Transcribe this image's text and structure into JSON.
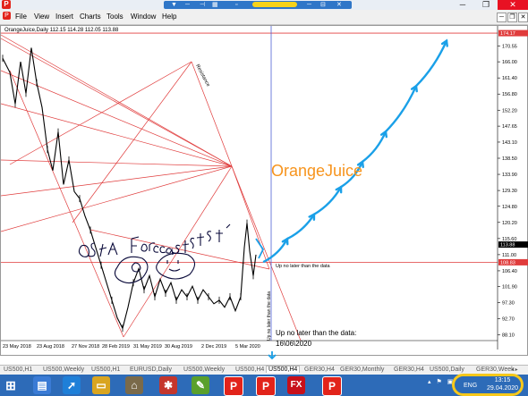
{
  "menu": [
    "File",
    "View",
    "Insert",
    "Charts",
    "Tools",
    "Window",
    "Help"
  ],
  "chart": {
    "header": "OrangeJuice,Daily  112.15 114.28 112.05 113.88",
    "watermark": "OrangeJuice",
    "note_short": "Up no later than the data",
    "note_vertical": "Up no later than the data",
    "note_long": [
      "Up no later than the data:",
      "16\\06\\2020"
    ],
    "trend_label": "Resistance",
    "current_price": "113.88",
    "line_price": "108.83",
    "top_price": "174.17"
  },
  "chart_data": {
    "type": "line",
    "title": "OrangeJuice,Daily",
    "symbol": "OrangeJuice",
    "timeframe": "Daily",
    "ohlc": {
      "open": 112.15,
      "high": 114.28,
      "low": 112.05,
      "close": 113.88
    },
    "x_ticks": [
      "23 May 2018",
      "23 Aug 2018",
      "27 Nov 2018",
      "28 Feb 2019",
      "31 May 2019",
      "30 Aug 2019",
      "2 Dec 2019",
      "5 Mar 2020"
    ],
    "y_ticks": [
      170.55,
      166.0,
      161.4,
      156.8,
      152.2,
      147.65,
      143.1,
      138.5,
      133.9,
      129.3,
      124.8,
      120.2,
      115.6,
      111.0,
      106.4,
      101.9,
      97.3,
      92.7,
      88.1
    ],
    "ylim": [
      86.5,
      174.7
    ],
    "price_labels": {
      "top_line": 174.17,
      "current": 113.88,
      "horizontal_line": 108.83
    },
    "price_path": [
      {
        "x": 0,
        "y": 167
      },
      {
        "x": 8,
        "y": 163
      },
      {
        "x": 14,
        "y": 154
      },
      {
        "x": 20,
        "y": 166
      },
      {
        "x": 26,
        "y": 157
      },
      {
        "x": 32,
        "y": 170
      },
      {
        "x": 38,
        "y": 160
      },
      {
        "x": 44,
        "y": 153
      },
      {
        "x": 50,
        "y": 141
      },
      {
        "x": 56,
        "y": 135
      },
      {
        "x": 62,
        "y": 146
      },
      {
        "x": 68,
        "y": 131
      },
      {
        "x": 74,
        "y": 138
      },
      {
        "x": 80,
        "y": 129
      },
      {
        "x": 86,
        "y": 127
      },
      {
        "x": 92,
        "y": 122
      },
      {
        "x": 98,
        "y": 118
      },
      {
        "x": 104,
        "y": 113
      },
      {
        "x": 110,
        "y": 108
      },
      {
        "x": 116,
        "y": 103
      },
      {
        "x": 122,
        "y": 98
      },
      {
        "x": 128,
        "y": 93
      },
      {
        "x": 134,
        "y": 90
      },
      {
        "x": 140,
        "y": 96
      },
      {
        "x": 146,
        "y": 103
      },
      {
        "x": 152,
        "y": 107
      },
      {
        "x": 158,
        "y": 101
      },
      {
        "x": 164,
        "y": 105
      },
      {
        "x": 170,
        "y": 99
      },
      {
        "x": 176,
        "y": 104
      },
      {
        "x": 182,
        "y": 100
      },
      {
        "x": 188,
        "y": 103
      },
      {
        "x": 194,
        "y": 98
      },
      {
        "x": 200,
        "y": 101
      },
      {
        "x": 206,
        "y": 99
      },
      {
        "x": 212,
        "y": 102
      },
      {
        "x": 218,
        "y": 98
      },
      {
        "x": 224,
        "y": 101
      },
      {
        "x": 230,
        "y": 99
      },
      {
        "x": 236,
        "y": 97
      },
      {
        "x": 242,
        "y": 98
      },
      {
        "x": 248,
        "y": 96
      },
      {
        "x": 254,
        "y": 99
      },
      {
        "x": 260,
        "y": 95
      },
      {
        "x": 266,
        "y": 99
      },
      {
        "x": 270,
        "y": 113
      },
      {
        "x": 273,
        "y": 120
      },
      {
        "x": 276,
        "y": 112
      },
      {
        "x": 280,
        "y": 105
      },
      {
        "x": 283,
        "y": 111
      }
    ],
    "forecast_path": [
      {
        "x": 292,
        "y": 109.0
      },
      {
        "x": 318,
        "y": 115.5
      },
      {
        "x": 348,
        "y": 122.5
      },
      {
        "x": 378,
        "y": 130.3
      },
      {
        "x": 402,
        "y": 137.5
      },
      {
        "x": 428,
        "y": 146.1
      },
      {
        "x": 462,
        "y": 159.1
      },
      {
        "x": 496,
        "y": 172.0
      }
    ]
  },
  "tabs": [
    "US500,H1",
    "US500,Weekly",
    "US500,H1",
    "EURUSD,Daily",
    "US500,Weekly",
    "US500,H4",
    "US500,H4",
    "GER30,H4",
    "GER30,Monthly",
    "GER30,H4",
    "US500,Daily",
    "GER30,Week"
  ],
  "active_tab": 6,
  "tray": {
    "lang": "ENG",
    "time": "13:15",
    "date": "29.04.2020"
  },
  "colors": {
    "price": "#000000",
    "fib": "#e03c3c",
    "forecast": "#1aa0e8",
    "watermark": "#f7941d",
    "scribble": "#0a0a3a"
  }
}
